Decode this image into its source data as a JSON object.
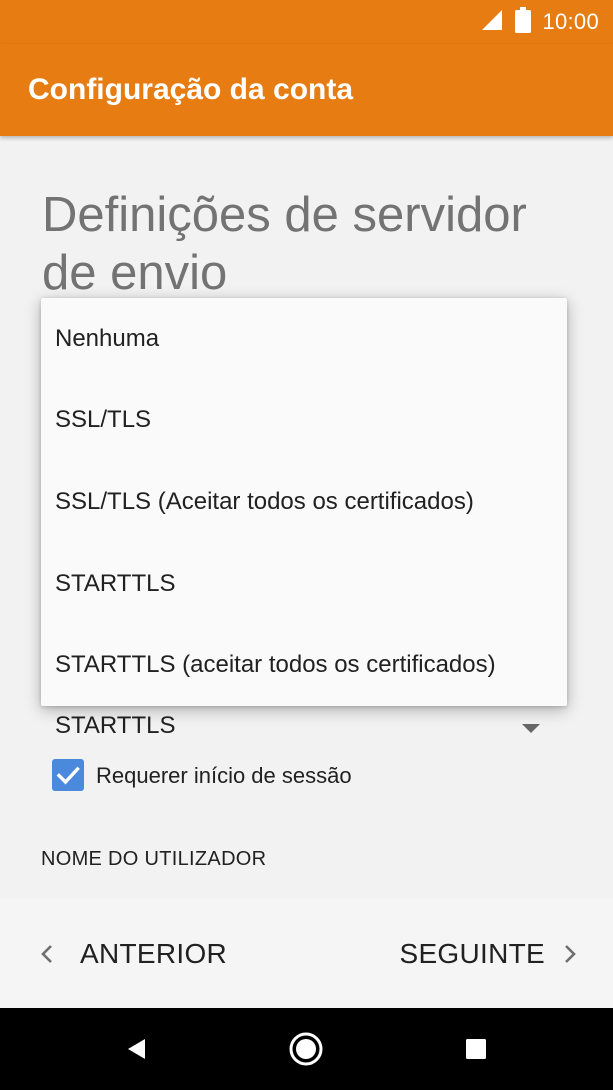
{
  "status_bar": {
    "time": "10:00",
    "icons": [
      "signal-icon",
      "battery-icon"
    ],
    "background": "#e67c12"
  },
  "app_bar": {
    "title": "Configuração da conta",
    "background": "#e67c12"
  },
  "page": {
    "heading": "Definições de servidor de envio"
  },
  "security": {
    "selected_value": "STARTTLS",
    "options": [
      "Nenhuma",
      "SSL/TLS",
      "SSL/TLS (Aceitar todos os certificados)",
      "STARTTLS",
      "STARTTLS (aceitar todos os certificados)"
    ]
  },
  "login": {
    "checkbox_label": "Requerer início de sessão",
    "checked": true,
    "checkbox_color": "#4a89dc"
  },
  "username": {
    "label": "NOME DO UTILIZADOR"
  },
  "navigation": {
    "previous_label": "ANTERIOR",
    "next_label": "SEGUINTE"
  },
  "system_nav": {
    "buttons": [
      "back-icon",
      "home-icon",
      "recents-icon"
    ]
  }
}
